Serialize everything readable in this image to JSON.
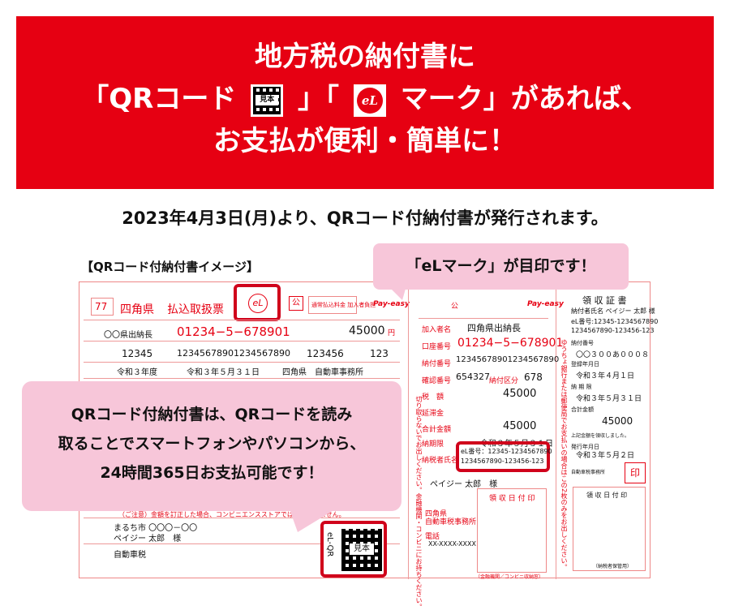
{
  "banner": {
    "line1": "地方税の納付書に",
    "line2_open": "「QRコード",
    "line2_mid": "」「",
    "line2_close": "マーク」があれば、",
    "line3": "お支払が便利・簡単に！",
    "qr_icon_text": "見本",
    "el_icon_text": "eL"
  },
  "date_notice": "2023年4月3日(月)より、QRコード付納付書が発行されます。",
  "image_label": "【QRコード付納付書イメージ】",
  "callout_top": "「eLマーク」が目印です！",
  "callout_main": {
    "line1": "QRコード付納付書は、QRコードを読み",
    "line2": "取ることでスマートフォンやパソコンから、",
    "line3": "24時間365日お支払可能です！"
  },
  "form": {
    "code": "77",
    "prefecture": "四角県",
    "title": "払込取扱票",
    "el_mark": "eL",
    "ko": "公",
    "stamp_label": "通常払込料金\n加入者負担",
    "payeasy": "Pay-easy",
    "account_number": "01234−5−678901",
    "amount_left": "45000",
    "yen": "円",
    "kanyu_name": "〇〇県出納長",
    "shuno_code": "12345",
    "nofu_number": "12345678901234567890",
    "kakunin": "123456",
    "nofu_kubun": "123",
    "kaikei_nendo": "令和３年度",
    "kigen": "令和３年５月３１日",
    "office": "四角県　自動車事務所",
    "address": "まるち市 〇〇〇－〇〇",
    "payer": "ペイジー 太郎　様",
    "tax": "自動車税",
    "bottom_note": "（ご注意）金額を訂正した場合、コンビニエンスストアでは納付できません。",
    "el_qr_label": "eL-QR",
    "qr_sample": "見本",
    "mid": {
      "kanyu_name_label": "加入者名",
      "kanyu_name": "四角県出納長",
      "ko_number_label": "口座番号",
      "ko_number": "01234−5−678901",
      "nofu_number_label": "納付番号",
      "nofu_number": "12345678901234567890",
      "kakunin_label": "確認番号",
      "kakunin": "654327",
      "kubun_label": "納付区分",
      "kubun": "678",
      "zeigaku_label": "税　額",
      "zeigaku": "45000",
      "entai_label": "延滞金",
      "total_label": "合計金額",
      "total": "45000",
      "kigen_label": "納期限",
      "kigen": "令和３年５月３１日",
      "nozeisha_label": "納税者氏名",
      "el_number_1": "eL番号：12345-1234567890",
      "el_number_2": "1234567890-123456-123",
      "payer": "ペイジー 太郎　様",
      "office_1": "四角県",
      "office_2": "自動車税事務所",
      "phone_label": "電話",
      "phone": "XX-XXXX-XXXX",
      "shunou_label": "領 収 日 付 印",
      "vertical_note": "切り取らないでお出しください。金融機関・コンビニにお持ちください。",
      "bank_label": "（金融機関／コンビニ収納窓）"
    },
    "right": {
      "title": "領 収 証 書",
      "payer_label": "納付者氏名 ペイジー 太郎 様",
      "el_number_1": "eL番号:12345-1234567890",
      "el_number_2": "1234567890-123456-123",
      "nofu_number_label": "納付番号",
      "nofu_number": "〇〇３００あ０００８",
      "registered_label": "登録年月日",
      "registered": "令和３年４月１日",
      "kigen_label": "納 期 限",
      "kigen": "令和３年５月３１日",
      "total_label": "合計金額",
      "total": "45000",
      "received_note": "上記金額を領収しました。",
      "issue_label": "発行年月日",
      "issue_date": "令和３年５月２日",
      "office": "自動車税事務所",
      "stamp": "印",
      "receipt_box": "領 収 日 付 印",
      "receipt_sub": "（納税者保管用）",
      "vertical_note": "ゆうちょ銀行または郵便局でお支払いの場合はこの2枚のみをお出しください。"
    }
  }
}
